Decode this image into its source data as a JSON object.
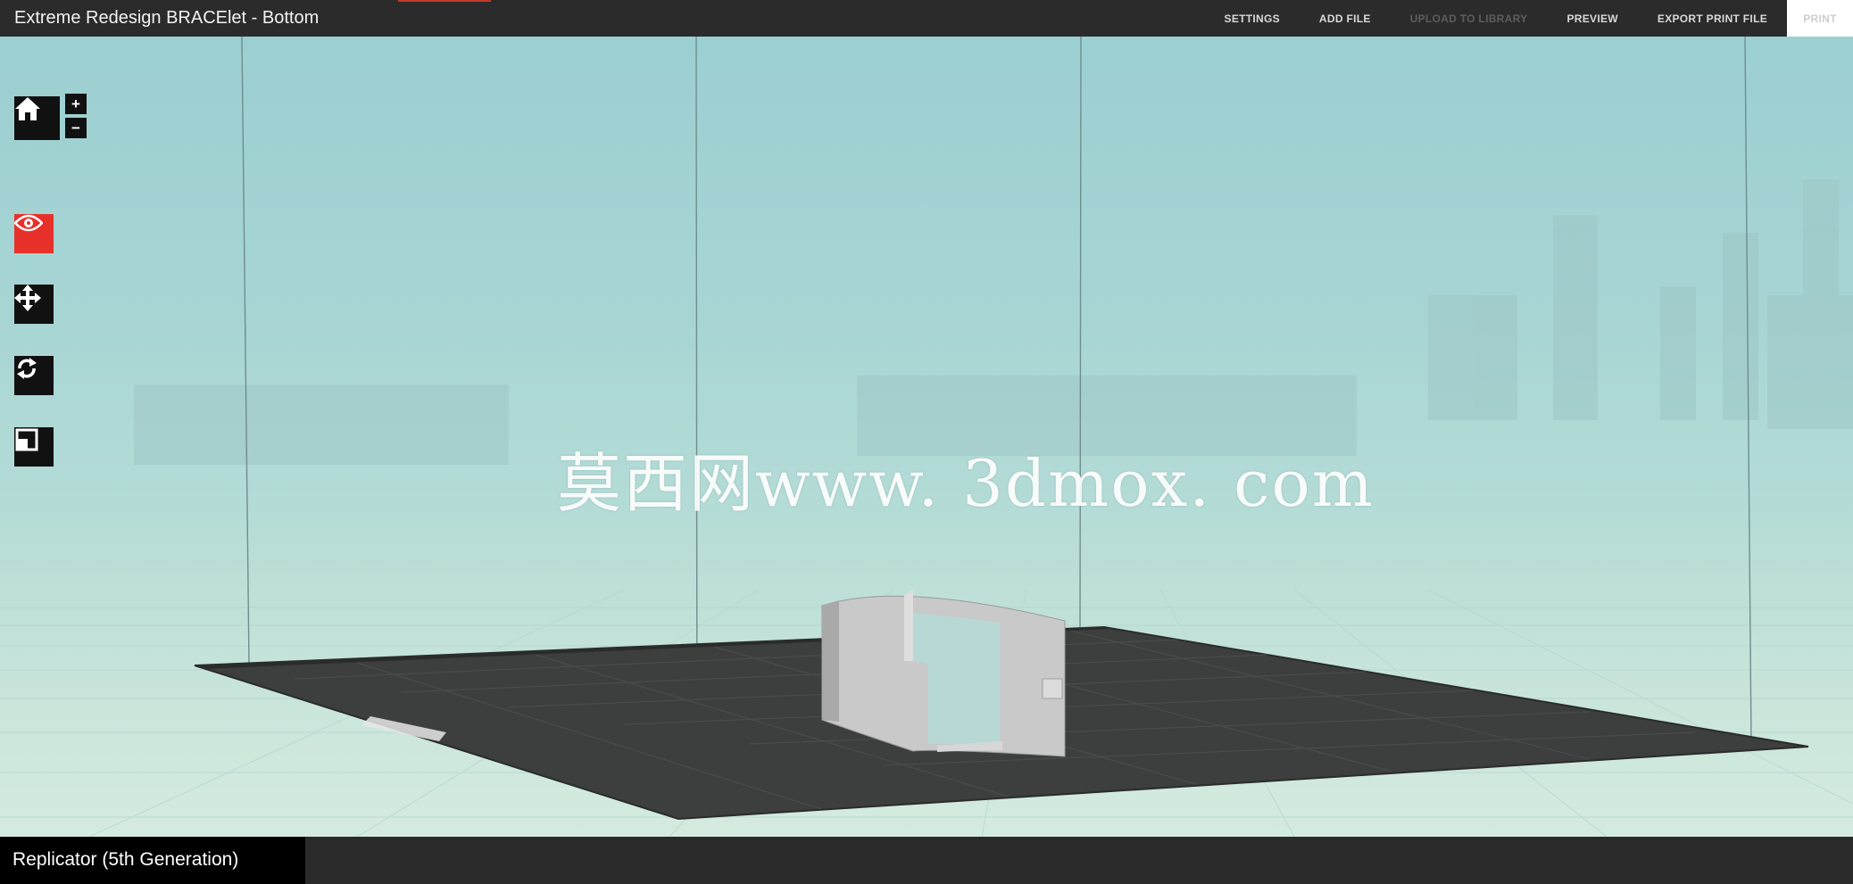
{
  "window": {
    "title": "Extreme Redesign BRACElet - Bottom"
  },
  "nav": {
    "settings": "SETTINGS",
    "add_file": "ADD FILE",
    "upload": "UPLOAD TO LIBRARY",
    "preview": "PREVIEW",
    "export": "EXPORT PRINT FILE",
    "print": "PRINT"
  },
  "tools": {
    "home_icon": "home-icon",
    "zoom_in": "+",
    "zoom_out": "−",
    "view_icon": "eye-icon",
    "move_icon": "move-arrows-icon",
    "rotate_icon": "rotate-icon",
    "scale_icon": "scale-icon"
  },
  "viewport": {
    "watermark": "莫西网www. 3dmox. com",
    "model_name": "bracelet-model"
  },
  "printer": {
    "name": "Replicator (5th Generation)"
  },
  "colors": {
    "accent": "#e8302a",
    "topbar": "#2b2b2b",
    "platform": "#3c3f3e",
    "sky": "#a6d4d3"
  }
}
